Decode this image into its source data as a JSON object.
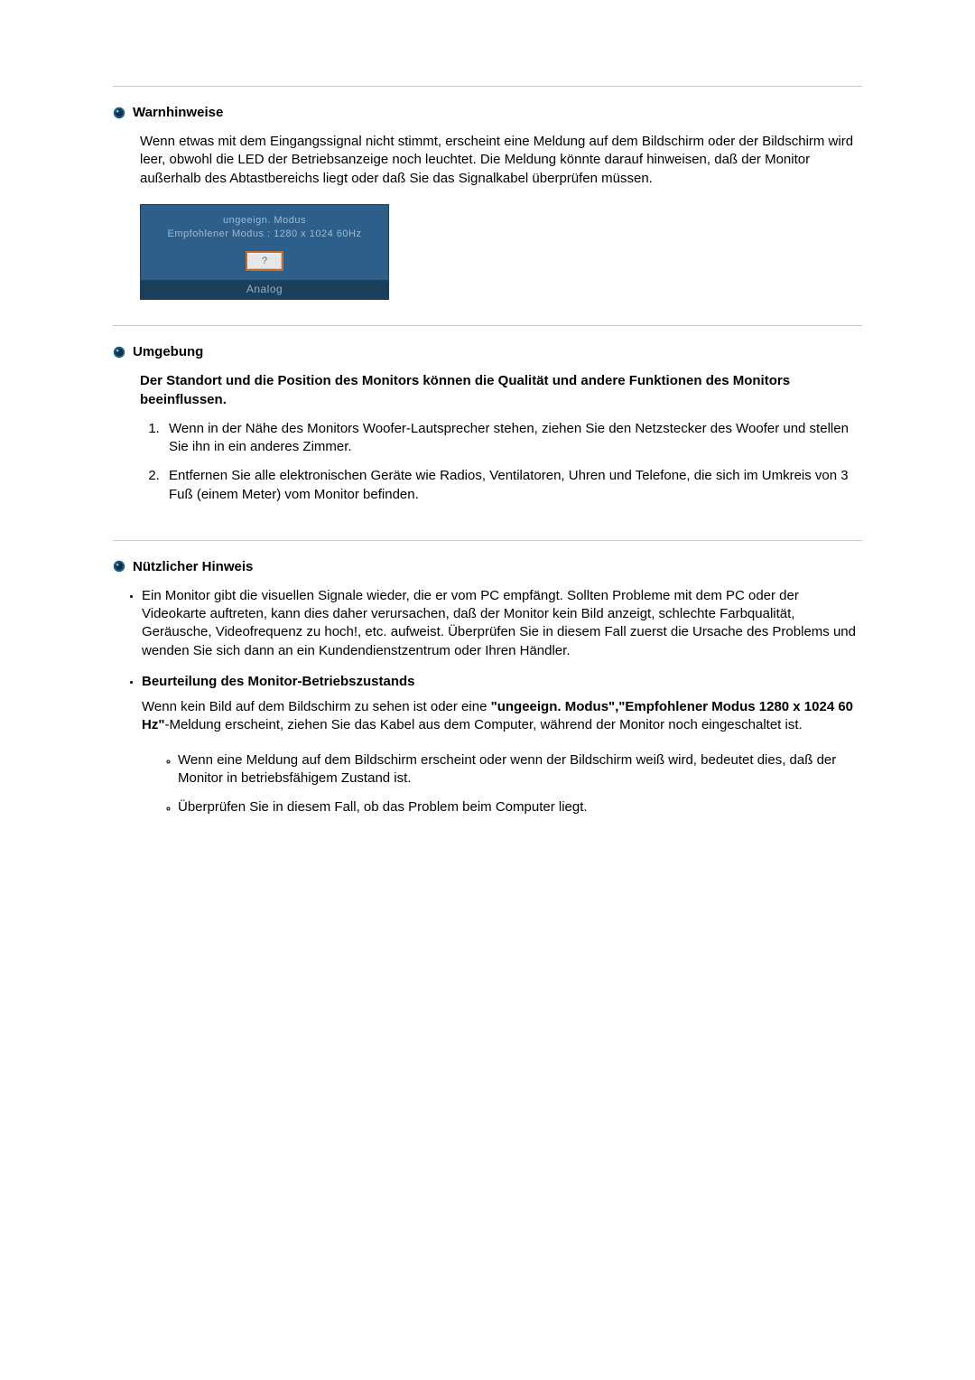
{
  "sections": {
    "warn": {
      "title": "Warnhinweise",
      "body": "Wenn etwas mit dem Eingangssignal nicht stimmt, erscheint eine Meldung auf dem Bildschirm oder der Bildschirm wird leer, obwohl die LED der Betriebsanzeige noch leuchtet. Die Meldung könnte darauf hinweisen, daß der Monitor außerhalb des Abtastbereichs liegt oder daß Sie das Signalkabel überprüfen müssen.",
      "osd": {
        "line1": "ungeeign. Modus",
        "line2": "Empfohlener Modus : 1280 x 1024  60Hz",
        "button": "?",
        "footer": "Analog"
      }
    },
    "env": {
      "title": "Umgebung",
      "intro": "Der Standort und die Position des Monitors können die Qualität und andere Funktionen des Monitors beeinflussen.",
      "items": [
        "Wenn in der Nähe des Monitors Woofer-Lautsprecher stehen, ziehen Sie den Netzstecker des Woofer und stellen Sie ihn in ein anderes Zimmer.",
        "Entfernen Sie alle elektronischen Geräte wie Radios, Ventilatoren, Uhren und Telefone, die sich im Umkreis von 3 Fuß (einem Meter) vom Monitor befinden."
      ]
    },
    "hint": {
      "title": "Nützlicher Hinweis",
      "para1": "Ein Monitor gibt die visuellen Signale wieder, die er vom PC empfängt. Sollten Probleme mit dem PC oder der Videokarte auftreten, kann dies daher verursachen, daß der Monitor kein Bild anzeigt, schlechte Farbqualität, Geräusche, Videofrequenz zu hoch!, etc. aufweist. Überprüfen Sie in diesem Fall zuerst die Ursache des Problems und wenden Sie sich dann an ein Kundendienstzentrum oder Ihren Händler.",
      "subhead": "Beurteilung des Monitor-Betriebszustands",
      "para2_pre": "Wenn kein Bild auf dem Bildschirm zu sehen ist oder eine ",
      "para2_bold": "\"ungeeign. Modus\",\"Empfohlener Modus 1280 x 1024 60 Hz\"",
      "para2_post": "-Meldung erscheint, ziehen Sie das Kabel aus dem Computer, während der Monitor noch eingeschaltet ist.",
      "subitems": [
        "Wenn eine Meldung auf dem Bildschirm erscheint oder wenn der Bildschirm weiß wird, bedeutet dies, daß der Monitor in betriebsfähigem Zustand ist.",
        "Überprüfen Sie in diesem Fall, ob das Problem beim Computer liegt."
      ]
    }
  }
}
